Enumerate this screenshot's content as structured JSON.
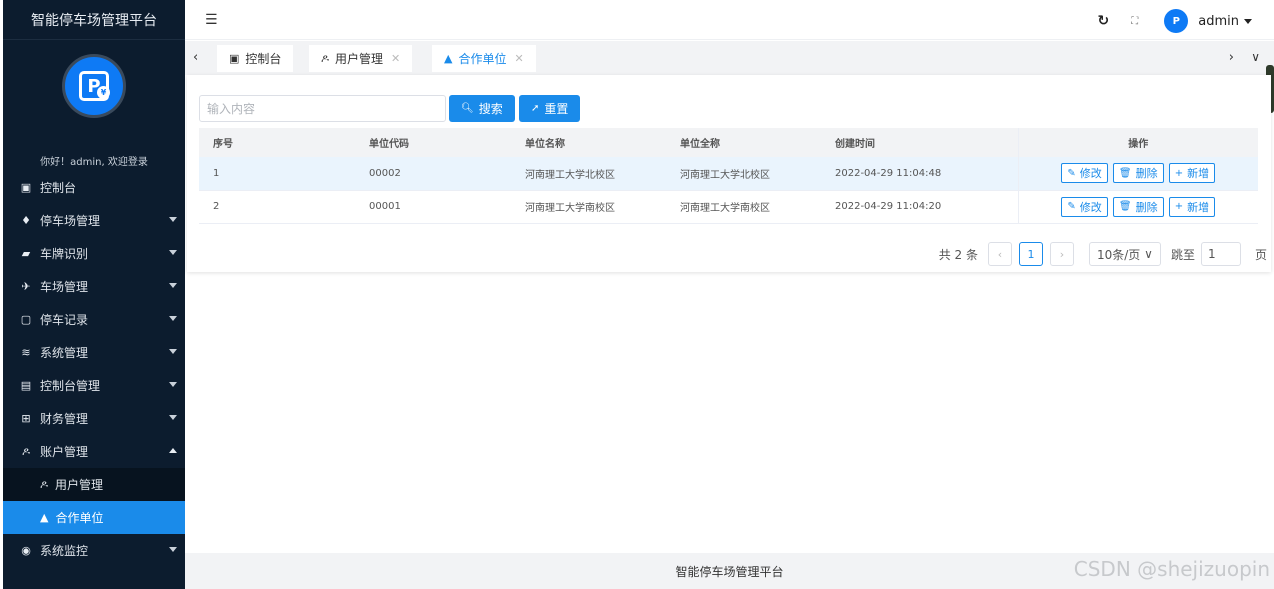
{
  "sidebar": {
    "brand": "智能停车场管理平台",
    "welcome": "你好！admin, 欢迎登录",
    "items": [
      {
        "label": "控制台",
        "icon": "▣"
      },
      {
        "label": "停车场管理",
        "icon": "♦"
      },
      {
        "label": "车牌识别",
        "icon": "▰"
      },
      {
        "label": "车场管理",
        "icon": "✈"
      },
      {
        "label": "停车记录",
        "icon": "▢"
      },
      {
        "label": "系统管理",
        "icon": "≋"
      },
      {
        "label": "控制台管理",
        "icon": "▤"
      },
      {
        "label": "财务管理",
        "icon": "⊞"
      },
      {
        "label": "账户管理",
        "icon": "ዶ"
      },
      {
        "label": "用户管理",
        "icon": "ዶ"
      },
      {
        "label": "合作单位",
        "icon": "▲"
      },
      {
        "label": "系统监控",
        "icon": "◉"
      }
    ]
  },
  "topbar": {
    "username": "admin"
  },
  "tabs": [
    {
      "label": "控制台"
    },
    {
      "label": "用户管理"
    },
    {
      "label": "合作单位"
    }
  ],
  "search": {
    "placeholder": "输入内容",
    "search_label": "搜索",
    "reset_label": "重置"
  },
  "table": {
    "headers": [
      "序号",
      "单位代码",
      "单位名称",
      "单位全称",
      "创建时间",
      "操作"
    ],
    "rows": [
      [
        "1",
        "00002",
        "河南理工大学北校区",
        "河南理工大学北校区",
        "2022-04-29 11:04:48"
      ],
      [
        "2",
        "00001",
        "河南理工大学南校区",
        "河南理工大学南校区",
        "2022-04-29 11:04:20"
      ]
    ],
    "actions": {
      "edit": "修改",
      "delete": "删除",
      "add": "新增"
    }
  },
  "pagination": {
    "total": "共 2 条",
    "current": "1",
    "page_size": "10条/页",
    "jump_label": "跳至",
    "jump_value": "1",
    "page_suffix": "页"
  },
  "footer": {
    "text": "智能停车场管理平台"
  },
  "watermark": "CSDN @shejizuopin",
  "colors": {
    "sidebar_bg": "#0c1c2e",
    "accent": "#1a8bea"
  }
}
